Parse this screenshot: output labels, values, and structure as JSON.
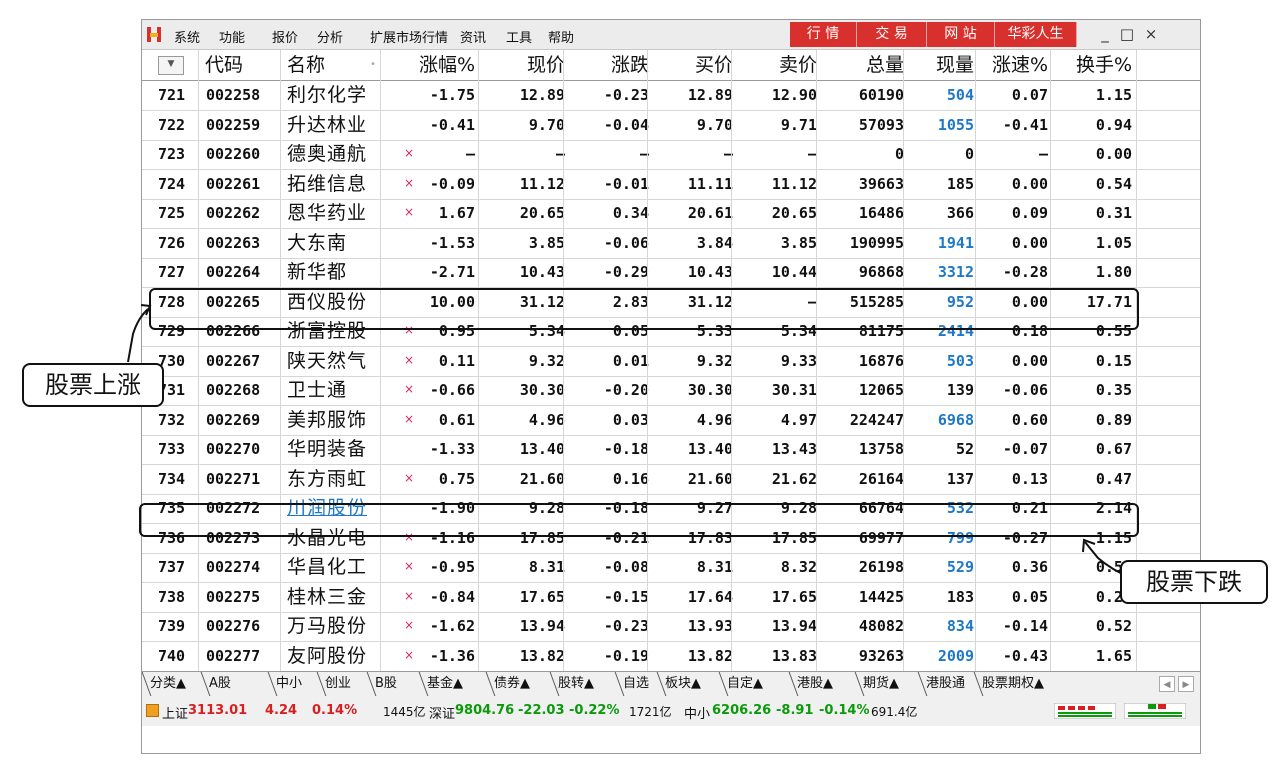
{
  "menubar": {
    "items": [
      "系统",
      "功能",
      "报价",
      "分析",
      "扩展市场行情",
      "资讯",
      "工具",
      "帮助"
    ],
    "red_buttons": [
      "行 情",
      "交 易",
      "网 站",
      "华彩人生"
    ],
    "colors": {
      "red_button": "#d8302c",
      "up": "#d81e1e",
      "down": "#0a9a0a",
      "blue": "#1e78c8"
    }
  },
  "table": {
    "columns": [
      "代码",
      "名称",
      "涨幅%",
      "现价",
      "涨跌",
      "买价",
      "卖价",
      "总量",
      "现量",
      "涨速%",
      "换手%"
    ],
    "rows": [
      {
        "idx": "721",
        "code": "002258",
        "name": "利尔化学",
        "mark": "",
        "chg_pct": "-1.75",
        "price": "12.89",
        "chg": "-0.23",
        "bid": "12.89",
        "ask": "12.90",
        "vol": "60190",
        "cur_vol": "504",
        "cur_blue": true,
        "speed": "0.07",
        "turnover": "1.15"
      },
      {
        "idx": "722",
        "code": "002259",
        "name": "升达林业",
        "mark": "",
        "chg_pct": "-0.41",
        "price": "9.70",
        "chg": "-0.04",
        "bid": "9.70",
        "ask": "9.71",
        "vol": "57093",
        "cur_vol": "1055",
        "cur_blue": true,
        "speed": "-0.41",
        "turnover": "0.94"
      },
      {
        "idx": "723",
        "code": "002260",
        "name": "德奥通航",
        "mark": "×",
        "chg_pct": "—",
        "price": "—",
        "chg": "—",
        "bid": "—",
        "ask": "—",
        "vol": "0",
        "cur_vol": "0",
        "cur_blue": false,
        "speed": "—",
        "turnover": "0.00"
      },
      {
        "idx": "724",
        "code": "002261",
        "name": "拓维信息",
        "mark": "×",
        "chg_pct": "-0.09",
        "price": "11.12",
        "chg": "-0.01",
        "bid": "11.11",
        "ask": "11.12",
        "vol": "39663",
        "cur_vol": "185",
        "cur_blue": false,
        "speed": "0.00",
        "turnover": "0.54"
      },
      {
        "idx": "725",
        "code": "002262",
        "name": "恩华药业",
        "mark": "×",
        "chg_pct": "1.67",
        "price": "20.65",
        "chg": "0.34",
        "bid": "20.61",
        "ask": "20.65",
        "vol": "16486",
        "cur_vol": "366",
        "cur_blue": false,
        "speed": "0.09",
        "turnover": "0.31"
      },
      {
        "idx": "726",
        "code": "002263",
        "name": "大东南",
        "mark": "",
        "chg_pct": "-1.53",
        "price": "3.85",
        "chg": "-0.06",
        "bid": "3.84",
        "ask": "3.85",
        "vol": "190995",
        "cur_vol": "1941",
        "cur_blue": true,
        "speed": "0.00",
        "turnover": "1.05"
      },
      {
        "idx": "727",
        "code": "002264",
        "name": "新华都",
        "mark": "",
        "chg_pct": "-2.71",
        "price": "10.43",
        "chg": "-0.29",
        "bid": "10.43",
        "ask": "10.44",
        "vol": "96868",
        "cur_vol": "3312",
        "cur_blue": true,
        "speed": "-0.28",
        "turnover": "1.80"
      },
      {
        "idx": "728",
        "code": "002265",
        "name": "西仪股份",
        "mark": "",
        "chg_pct": "10.00",
        "price": "31.12",
        "chg": "2.83",
        "bid": "31.12",
        "ask": "—",
        "vol": "515285",
        "cur_vol": "952",
        "cur_blue": true,
        "speed": "0.00",
        "turnover": "17.71"
      },
      {
        "idx": "729",
        "code": "002266",
        "name": "浙富控股",
        "mark": "×",
        "chg_pct": "0.95",
        "price": "5.34",
        "chg": "0.05",
        "bid": "5.33",
        "ask": "5.34",
        "vol": "81175",
        "cur_vol": "2414",
        "cur_blue": true,
        "speed": "0.18",
        "turnover": "0.55"
      },
      {
        "idx": "730",
        "code": "002267",
        "name": "陕天然气",
        "mark": "×",
        "chg_pct": "0.11",
        "price": "9.32",
        "chg": "0.01",
        "bid": "9.32",
        "ask": "9.33",
        "vol": "16876",
        "cur_vol": "503",
        "cur_blue": true,
        "speed": "0.00",
        "turnover": "0.15"
      },
      {
        "idx": "731",
        "code": "002268",
        "name": "卫士通",
        "mark": "×",
        "chg_pct": "-0.66",
        "price": "30.30",
        "chg": "-0.20",
        "bid": "30.30",
        "ask": "30.31",
        "vol": "12065",
        "cur_vol": "139",
        "cur_blue": false,
        "speed": "-0.06",
        "turnover": "0.35"
      },
      {
        "idx": "732",
        "code": "002269",
        "name": "美邦服饰",
        "mark": "×",
        "chg_pct": "0.61",
        "price": "4.96",
        "chg": "0.03",
        "bid": "4.96",
        "ask": "4.97",
        "vol": "224247",
        "cur_vol": "6968",
        "cur_blue": true,
        "speed": "0.60",
        "turnover": "0.89"
      },
      {
        "idx": "733",
        "code": "002270",
        "name": "华明装备",
        "mark": "",
        "chg_pct": "-1.33",
        "price": "13.40",
        "chg": "-0.18",
        "bid": "13.40",
        "ask": "13.43",
        "vol": "13758",
        "cur_vol": "52",
        "cur_blue": false,
        "speed": "-0.07",
        "turnover": "0.67"
      },
      {
        "idx": "734",
        "code": "002271",
        "name": "东方雨虹",
        "mark": "×",
        "chg_pct": "0.75",
        "price": "21.60",
        "chg": "0.16",
        "bid": "21.60",
        "ask": "21.62",
        "vol": "26164",
        "cur_vol": "137",
        "cur_blue": false,
        "speed": "0.13",
        "turnover": "0.47"
      },
      {
        "idx": "735",
        "code": "002272",
        "name": "川润股份",
        "mark": "",
        "chg_pct": "-1.90",
        "price": "9.28",
        "chg": "-0.18",
        "bid": "9.27",
        "ask": "9.28",
        "vol": "66764",
        "cur_vol": "532",
        "cur_blue": true,
        "speed": "0.21",
        "turnover": "2.14",
        "name_blue": true
      },
      {
        "idx": "736",
        "code": "002273",
        "name": "水晶光电",
        "mark": "×",
        "chg_pct": "-1.16",
        "price": "17.85",
        "chg": "-0.21",
        "bid": "17.83",
        "ask": "17.85",
        "vol": "69977",
        "cur_vol": "799",
        "cur_blue": true,
        "speed": "-0.27",
        "turnover": "1.15"
      },
      {
        "idx": "737",
        "code": "002274",
        "name": "华昌化工",
        "mark": "×",
        "chg_pct": "-0.95",
        "price": "8.31",
        "chg": "-0.08",
        "bid": "8.31",
        "ask": "8.32",
        "vol": "26198",
        "cur_vol": "529",
        "cur_blue": true,
        "speed": "0.36",
        "turnover": "0.59"
      },
      {
        "idx": "738",
        "code": "002275",
        "name": "桂林三金",
        "mark": "×",
        "chg_pct": "-0.84",
        "price": "17.65",
        "chg": "-0.15",
        "bid": "17.64",
        "ask": "17.65",
        "vol": "14425",
        "cur_vol": "183",
        "cur_blue": false,
        "speed": "0.05",
        "turnover": "0.27"
      },
      {
        "idx": "739",
        "code": "002276",
        "name": "万马股份",
        "mark": "×",
        "chg_pct": "-1.62",
        "price": "13.94",
        "chg": "-0.23",
        "bid": "13.93",
        "ask": "13.94",
        "vol": "48082",
        "cur_vol": "834",
        "cur_blue": true,
        "speed": "-0.14",
        "turnover": "0.52"
      },
      {
        "idx": "740",
        "code": "002277",
        "name": "友阿股份",
        "mark": "×",
        "chg_pct": "-1.36",
        "price": "13.82",
        "chg": "-0.19",
        "bid": "13.82",
        "ask": "13.83",
        "vol": "93263",
        "cur_vol": "2009",
        "cur_blue": true,
        "speed": "-0.43",
        "turnover": "1.65"
      }
    ]
  },
  "tabs": [
    "分类▲",
    "A股",
    "中小",
    "创业",
    "B股",
    "基金▲",
    "债券▲",
    "股转▲",
    "自选",
    "板块▲",
    "自定▲",
    "港股▲",
    "期货▲",
    "港股通",
    "股票期权▲"
  ],
  "status": {
    "sh_label": "上证",
    "sh_value": "3113.01",
    "sh_chg": "4.24",
    "sh_pct": "0.14%",
    "sh_amt": "1445亿",
    "sz_label": "深证",
    "sz_value": "9804.76",
    "sz_chg": "-22.03",
    "sz_pct": "-0.22%",
    "sz_amt": "1721亿",
    "zx_label": "中小",
    "zx_value": "6206.26",
    "zx_chg": "-8.91",
    "zx_pct": "-0.14%",
    "zx_amt": "691.4亿"
  },
  "annotations": {
    "rise_label": "股票上涨",
    "fall_label": "股票下跌"
  }
}
